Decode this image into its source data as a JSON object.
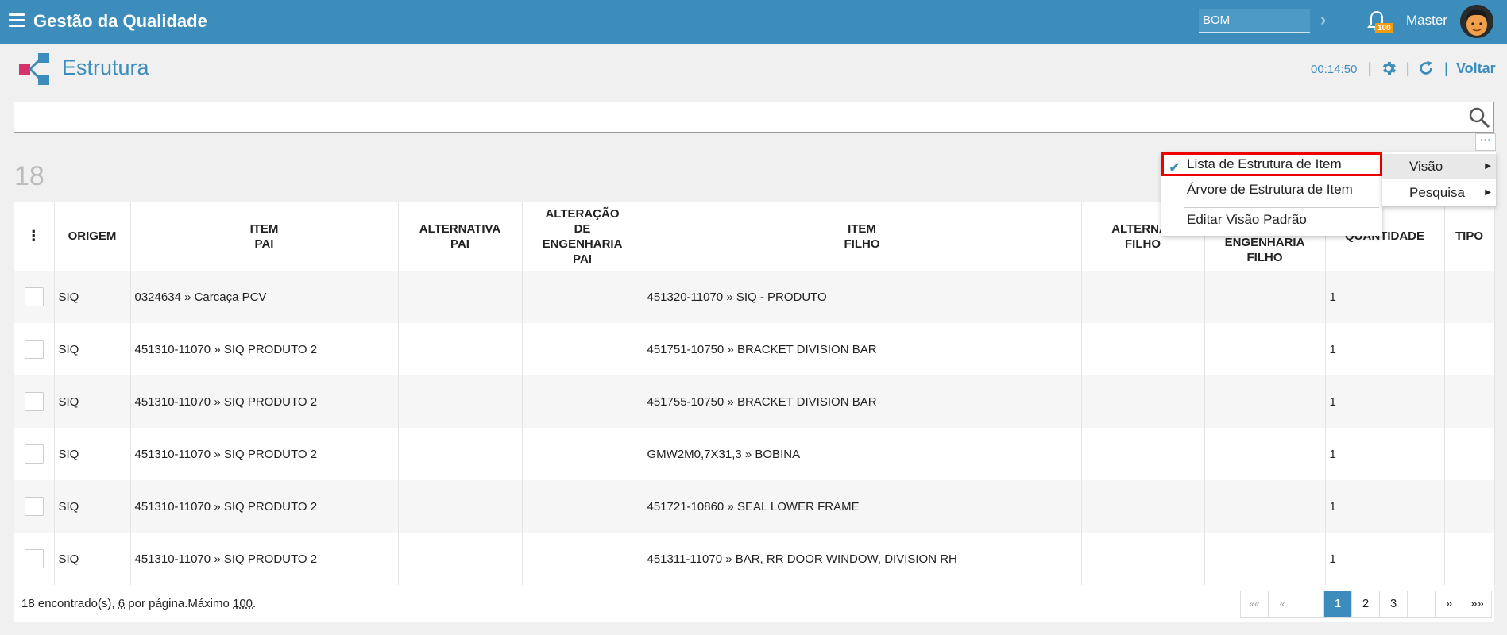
{
  "header": {
    "app_title": "Gestão da Qualidade",
    "module_select": "BOM",
    "notification_count": "100",
    "user_name": "Master",
    "brand_color": "#3c8dbc"
  },
  "page": {
    "title": "Estrutura",
    "timer": "00:14:50",
    "back_label": "Voltar"
  },
  "search": {
    "value": "",
    "placeholder": ""
  },
  "result_count": "18",
  "table": {
    "columns": [
      "",
      "ORIGEM",
      "ITEM\nPAI",
      "ALTERNATIVA\nPAI",
      "ALTERAÇÃO\nDE\nENGENHARIA\nPAI",
      "ITEM\nFILHO",
      "ALTERNAT\nFILHO",
      "ENGENHARIA\nFILHO",
      "QUANTIDADE",
      "TIPO"
    ],
    "rows": [
      {
        "origem": "SIQ",
        "item_pai": "0324634 » Carcaça PCV",
        "item_filho": "451320-11070 » SIQ - PRODUTO",
        "quantidade": "1"
      },
      {
        "origem": "SIQ",
        "item_pai": "451310-11070 » SIQ PRODUTO 2",
        "item_filho": "451751-10750 » BRACKET DIVISION BAR",
        "quantidade": "1"
      },
      {
        "origem": "SIQ",
        "item_pai": "451310-11070 » SIQ PRODUTO 2",
        "item_filho": "451755-10750 » BRACKET DIVISION BAR",
        "quantidade": "1"
      },
      {
        "origem": "SIQ",
        "item_pai": "451310-11070 » SIQ PRODUTO 2",
        "item_filho": "GMW2M0,7X31,3 » BOBINA",
        "quantidade": "1"
      },
      {
        "origem": "SIQ",
        "item_pai": "451310-11070 » SIQ PRODUTO 2",
        "item_filho": "451721-10860 » SEAL LOWER FRAME",
        "quantidade": "1"
      },
      {
        "origem": "SIQ",
        "item_pai": "451310-11070 » SIQ PRODUTO 2",
        "item_filho": "451311-11070 » BAR, RR DOOR WINDOW, DIVISION RH",
        "quantidade": "1"
      }
    ]
  },
  "footer": {
    "found_prefix": "18 encontrado(s), ",
    "per_page": "6",
    "per_page_suffix": " por página.Máximo ",
    "max": "100",
    "max_suffix": "."
  },
  "pagination": {
    "first": "««",
    "prev": "«",
    "pages": [
      "1",
      "2",
      "3"
    ],
    "current": "1",
    "next": "»",
    "last": "»»"
  },
  "menu": {
    "visao": "Visão",
    "pesquisa": "Pesquisa",
    "submenu": {
      "lista": "Lista de Estrutura de Item",
      "arvore": "Árvore de Estrutura de Item",
      "editar": "Editar Visão Padrão"
    }
  }
}
